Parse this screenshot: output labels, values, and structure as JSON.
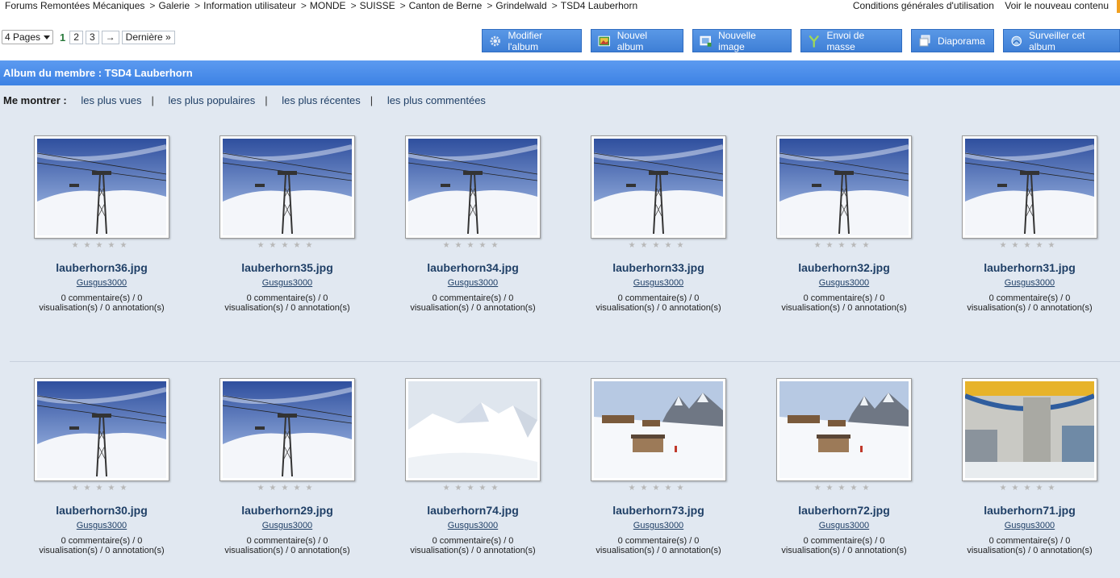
{
  "breadcrumb": [
    "Forums Remontées Mécaniques",
    "Galerie",
    "Information utilisateur",
    "MONDE",
    "SUISSE",
    "Canton de Berne",
    "Grindelwald",
    "TSD4 Lauberhorn"
  ],
  "top_links": {
    "terms": "Conditions générales d'utilisation",
    "new_content": "Voir le nouveau contenu"
  },
  "pagination": {
    "pages_label": "4 Pages",
    "current": "1",
    "pages": [
      "2",
      "3"
    ],
    "next": "→",
    "last": "Dernière »"
  },
  "toolbar": {
    "edit_album": "Modifier l'album",
    "new_album": "Nouvel album",
    "new_image": "Nouvelle image",
    "bulk_upload": "Envoi de masse",
    "slideshow": "Diaporama",
    "watch_album": "Surveiller cet album"
  },
  "album": {
    "title": "Album du membre : TSD4 Lauberhorn"
  },
  "filters": {
    "label": "Me montrer :",
    "most_viewed": "les plus vues",
    "most_popular": "les plus populaires",
    "most_recent": "les plus récentes",
    "most_commented": "les plus commentées",
    "separator": "|"
  },
  "rating_stars": "★★★★★",
  "images": [
    {
      "filename": "lauberhorn36.jpg",
      "user": "Gusgus3000",
      "stats_line1": "0 commentaire(s) / 0",
      "stats_line2": "visualisation(s) / 0 annotation(s)",
      "scene": "chairlift-tower"
    },
    {
      "filename": "lauberhorn35.jpg",
      "user": "Gusgus3000",
      "stats_line1": "0 commentaire(s) / 0",
      "stats_line2": "visualisation(s) / 0 annotation(s)",
      "scene": "chairlift-tower"
    },
    {
      "filename": "lauberhorn34.jpg",
      "user": "Gusgus3000",
      "stats_line1": "0 commentaire(s) / 0",
      "stats_line2": "visualisation(s) / 0 annotation(s)",
      "scene": "chairlift-tower"
    },
    {
      "filename": "lauberhorn33.jpg",
      "user": "Gusgus3000",
      "stats_line1": "0 commentaire(s) / 0",
      "stats_line2": "visualisation(s) / 0 annotation(s)",
      "scene": "chairlift-tower"
    },
    {
      "filename": "lauberhorn32.jpg",
      "user": "Gusgus3000",
      "stats_line1": "0 commentaire(s) / 0",
      "stats_line2": "visualisation(s) / 0 annotation(s)",
      "scene": "chairlift-tower"
    },
    {
      "filename": "lauberhorn31.jpg",
      "user": "Gusgus3000",
      "stats_line1": "0 commentaire(s) / 0",
      "stats_line2": "visualisation(s) / 0 annotation(s)",
      "scene": "chairlift-tower"
    },
    {
      "filename": "lauberhorn30.jpg",
      "user": "Gusgus3000",
      "stats_line1": "0 commentaire(s) / 0",
      "stats_line2": "visualisation(s) / 0 annotation(s)",
      "scene": "chairlift-tower"
    },
    {
      "filename": "lauberhorn29.jpg",
      "user": "Gusgus3000",
      "stats_line1": "0 commentaire(s) / 0",
      "stats_line2": "visualisation(s) / 0 annotation(s)",
      "scene": "chairlift-tower"
    },
    {
      "filename": "lauberhorn74.jpg",
      "user": "Gusgus3000",
      "stats_line1": "0 commentaire(s) / 0",
      "stats_line2": "visualisation(s) / 0 annotation(s)",
      "scene": "snowy-peaks"
    },
    {
      "filename": "lauberhorn73.jpg",
      "user": "Gusgus3000",
      "stats_line1": "0 commentaire(s) / 0",
      "stats_line2": "visualisation(s) / 0 annotation(s)",
      "scene": "ski-village"
    },
    {
      "filename": "lauberhorn72.jpg",
      "user": "Gusgus3000",
      "stats_line1": "0 commentaire(s) / 0",
      "stats_line2": "visualisation(s) / 0 annotation(s)",
      "scene": "ski-village"
    },
    {
      "filename": "lauberhorn71.jpg",
      "user": "Gusgus3000",
      "stats_line1": "0 commentaire(s) / 0",
      "stats_line2": "visualisation(s) / 0 annotation(s)",
      "scene": "lift-station"
    }
  ]
}
